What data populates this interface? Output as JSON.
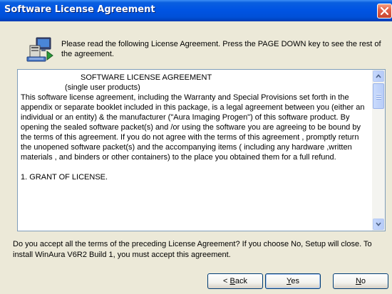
{
  "window": {
    "title": "Software License Agreement"
  },
  "header": {
    "instruction": "Please read the following License Agreement.  Press the PAGE DOWN key to see the rest of the agreement."
  },
  "license": {
    "heading": "SOFTWARE LICENSE AGREEMENT",
    "subheading": "(single user products)",
    "paragraph": "This software license agreement, including the Warranty and Special Provisions set forth in the appendix or separate booklet included in this package, is a legal agreement between you (either an individual or an entity) & the manufacturer (\"Aura Imaging Progen\") of this software product. By opening the sealed software packet(s) and /or using  the software you are agreeing to be bound by the terms of this agreement. If you do not agree with the terms of this agreement , promptly return the unopened  software packet(s)  and the accompanying items ( including any hardware ,written materials , and binders  or other containers) to the place you obtained them for a full refund.",
    "section1": "1.  GRANT OF LICENSE."
  },
  "question": "Do you accept all the terms of the preceding License Agreement?  If you choose No,  Setup will close.  To install WinAura V6R2 Build 1, you must accept this agreement.",
  "buttons": {
    "back_mnemonic": "B",
    "back_rest": "ack",
    "back_prefix": "< ",
    "yes_mnemonic": "Y",
    "yes_rest": "es",
    "no_mnemonic": "N",
    "no_rest": "o"
  },
  "icons": {
    "close": "close-icon",
    "setup": "computer-setup-icon",
    "scroll_up": "scroll-up-arrow-icon",
    "scroll_down": "scroll-down-arrow-icon"
  },
  "colors": {
    "titlebar": "#0054e3",
    "dialog_bg": "#ece9d8",
    "close_button": "#e2614a"
  }
}
